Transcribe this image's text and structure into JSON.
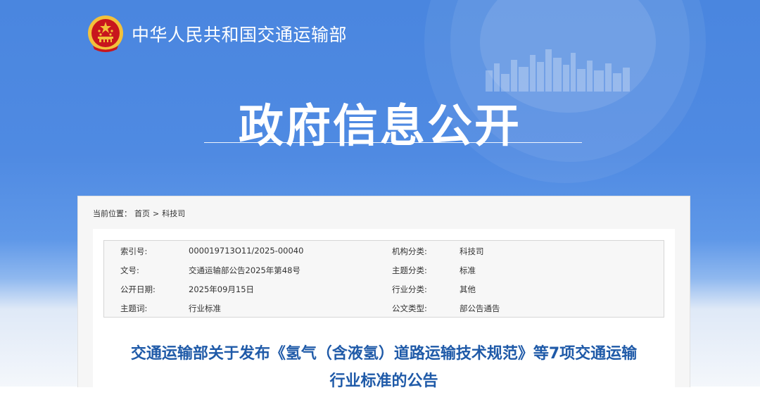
{
  "header": {
    "site_name": "中华人民共和国交通运输部",
    "hero_title": "政府信息公开"
  },
  "breadcrumb": {
    "label": "当前位置：",
    "home": "首页",
    "separator": ">",
    "current": "科技司"
  },
  "meta": {
    "rows": [
      {
        "k1": "索引号:",
        "v1": "000019713O11/2025-00040",
        "k2": "机构分类:",
        "v2": "科技司"
      },
      {
        "k1": "文号:",
        "v1": "交通运输部公告2025年第48号",
        "k2": "主题分类:",
        "v2": "标准"
      },
      {
        "k1": "公开日期:",
        "v1": "2025年09月15日",
        "k2": "行业分类:",
        "v2": "其他"
      },
      {
        "k1": "主题词:",
        "v1": "行业标准",
        "k2": "公文类型:",
        "v2": "部公告通告"
      }
    ]
  },
  "document": {
    "title_line1": "交通运输部关于发布《氢气（含液氢）道路运输技术规范》等7项交通运输",
    "title_line2": "行业标准的公告"
  },
  "colors": {
    "banner_blue": "#4a86df",
    "title_blue": "#1f5aa8",
    "emblem_red": "#c8161d",
    "emblem_gold": "#f3c13a"
  }
}
